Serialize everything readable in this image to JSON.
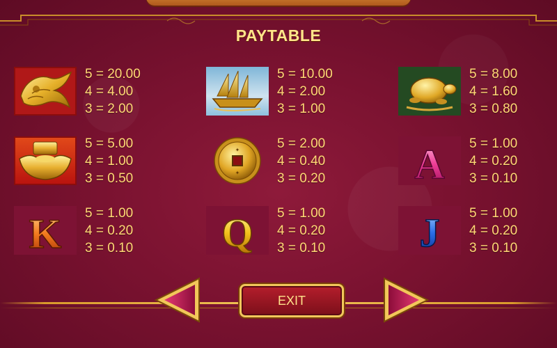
{
  "screen": {
    "title": "PAYTABLE",
    "exit_label": "EXIT"
  },
  "symbols": [
    {
      "name": "golden-phoenix",
      "pays": [
        "5 = 20.00",
        "4 = 4.00",
        "3 = 2.00"
      ]
    },
    {
      "name": "junk-ship",
      "pays": [
        "5 = 10.00",
        "4 = 2.00",
        "3 = 1.00"
      ]
    },
    {
      "name": "golden-turtle",
      "pays": [
        "5 = 8.00",
        "4 = 1.60",
        "3 = 0.80"
      ]
    },
    {
      "name": "gold-ingot",
      "pays": [
        "5 = 5.00",
        "4 = 1.00",
        "3 = 0.50"
      ]
    },
    {
      "name": "gold-coin",
      "pays": [
        "5 = 2.00",
        "4 = 0.40",
        "3 = 0.20"
      ]
    },
    {
      "name": "letter-a",
      "glyph": "A",
      "pays": [
        "5 = 1.00",
        "4 = 0.20",
        "3 = 0.10"
      ]
    },
    {
      "name": "letter-k",
      "glyph": "K",
      "pays": [
        "5 = 1.00",
        "4 = 0.20",
        "3 = 0.10"
      ]
    },
    {
      "name": "letter-q",
      "glyph": "Q",
      "pays": [
        "5 = 1.00",
        "4 = 0.20",
        "3 = 0.10"
      ]
    },
    {
      "name": "letter-j",
      "glyph": "J",
      "pays": [
        "5 = 1.00",
        "4 = 0.20",
        "3 = 0.10"
      ]
    }
  ],
  "colors": {
    "background": "#7a1230",
    "text_gold": "#ffd874",
    "title_gold": "#ffe58a",
    "frame_gold": "#f1c75b"
  }
}
